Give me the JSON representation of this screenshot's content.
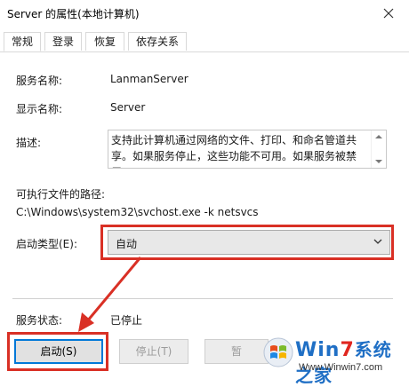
{
  "window": {
    "title": "Server 的属性(本地计算机)"
  },
  "tabs": [
    {
      "label": "常规"
    },
    {
      "label": "登录"
    },
    {
      "label": "恢复"
    },
    {
      "label": "依存关系"
    }
  ],
  "general": {
    "service_name_label": "服务名称:",
    "service_name_value": "LanmanServer",
    "display_name_label": "显示名称:",
    "display_name_value": "Server",
    "description_label": "描述:",
    "description_value": "支持此计算机通过网络的文件、打印、和命名管道共享。如果服务停止，这些功能不可用。如果服务被禁用，",
    "exe_path_label": "可执行文件的路径:",
    "exe_path_value": "C:\\Windows\\system32\\svchost.exe -k netsvcs",
    "startup_type_label": "启动类型(E):",
    "startup_type_value": "自动",
    "service_status_label": "服务状态:",
    "service_status_value": "已停止"
  },
  "buttons": {
    "start": "启动(S)",
    "stop": "停止(T)",
    "pause": "暂"
  },
  "watermark": {
    "brand_win": "Win",
    "brand_7": "7",
    "brand_cn": "系统之家",
    "url": "Www.Winwin7.com"
  },
  "annotation": {
    "color": "#d93025"
  }
}
